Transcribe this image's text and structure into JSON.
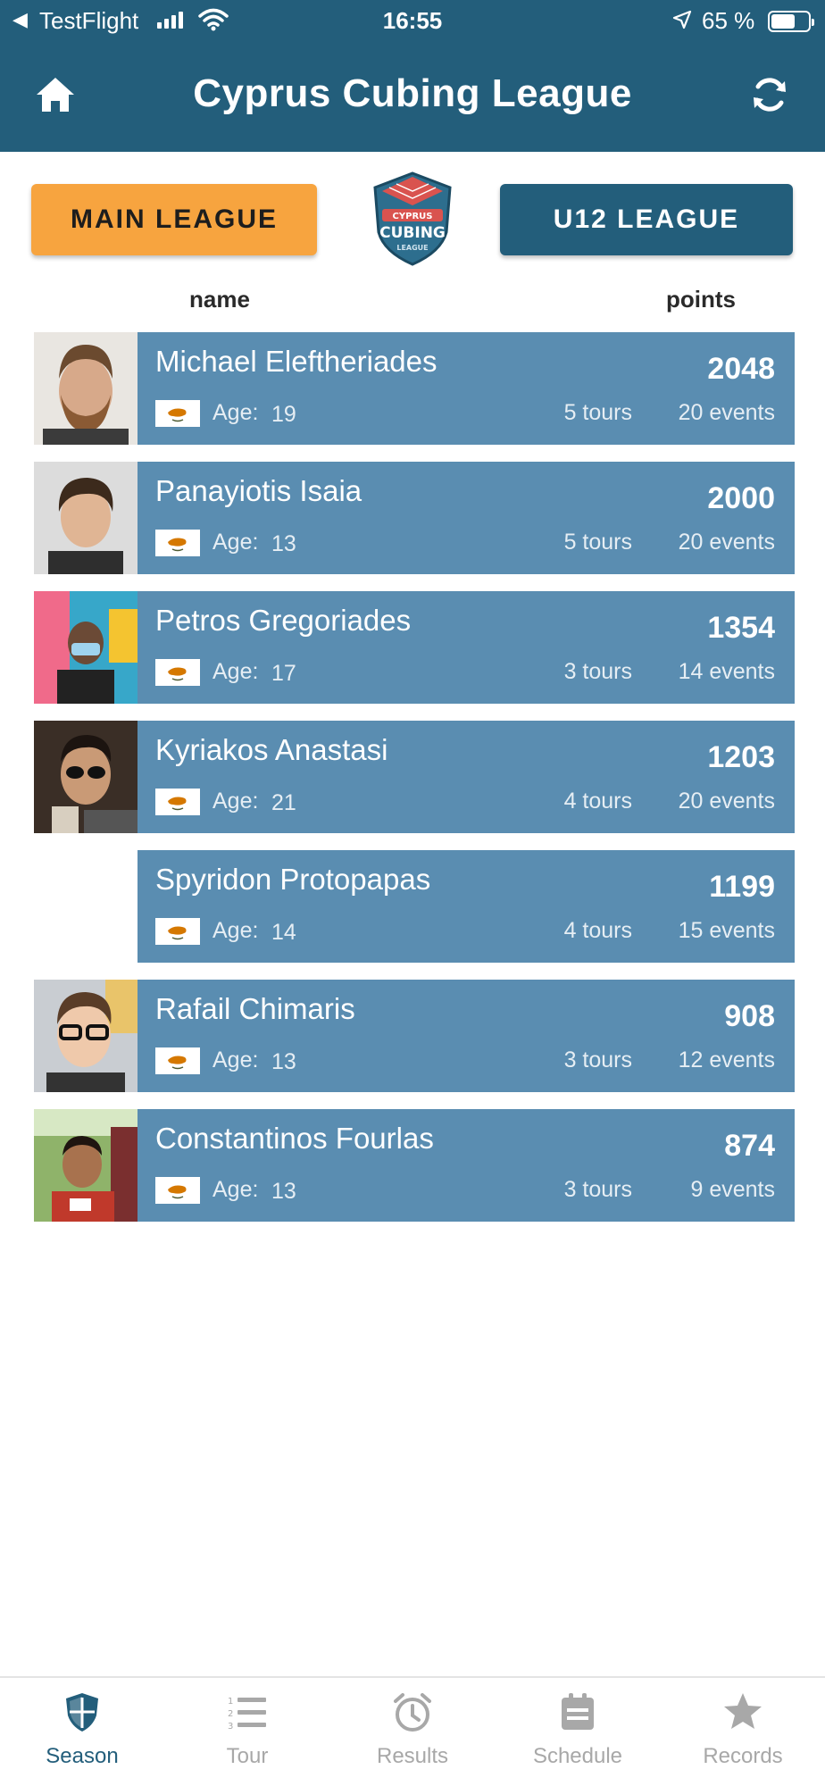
{
  "status_bar": {
    "back_glyph": "◀",
    "carrier": "TestFlight",
    "time": "16:55",
    "battery": "65 %"
  },
  "header": {
    "title": "Cyprus Cubing League",
    "home_icon": "home-icon",
    "refresh_icon": "refresh-icon"
  },
  "leagues": {
    "main_label": "MAIN LEAGUE",
    "u12_label": "U12 LEAGUE",
    "active": "main",
    "main_color": "#f7a43f",
    "u12_color": "#235e7b",
    "logo_text_top": "CYPRUS",
    "logo_text_mid": "CUBING",
    "logo_text_bottom": "LEAGUE"
  },
  "columns": {
    "name": "name",
    "points": "points"
  },
  "age_label": "Age:",
  "rankings": [
    {
      "name": "Michael Eleftheriades",
      "points": "2048",
      "age": "19",
      "tours": "5 tours",
      "events": "20 events",
      "has_photo": true
    },
    {
      "name": "Panayiotis Isaia",
      "points": "2000",
      "age": "13",
      "tours": "5 tours",
      "events": "20 events",
      "has_photo": true
    },
    {
      "name": "Petros Gregoriades",
      "points": "1354",
      "age": "17",
      "tours": "3 tours",
      "events": "14 events",
      "has_photo": true
    },
    {
      "name": "Kyriakos Anastasi",
      "points": "1203",
      "age": "21",
      "tours": "4 tours",
      "events": "20 events",
      "has_photo": true
    },
    {
      "name": "Spyridon Protopapas",
      "points": "1199",
      "age": "14",
      "tours": "4 tours",
      "events": "15 events",
      "has_photo": false
    },
    {
      "name": "Rafail Chimaris",
      "points": "908",
      "age": "13",
      "tours": "3 tours",
      "events": "12 events",
      "has_photo": true
    },
    {
      "name": "Constantinos Fourlas",
      "points": "874",
      "age": "13",
      "tours": "3 tours",
      "events": "9 events",
      "has_photo": true
    }
  ],
  "tabs": [
    {
      "label": "Season",
      "icon": "shield-icon",
      "active": true
    },
    {
      "label": "Tour",
      "icon": "numbered-list-icon",
      "active": false
    },
    {
      "label": "Results",
      "icon": "alarm-clock-icon",
      "active": false
    },
    {
      "label": "Schedule",
      "icon": "calendar-icon",
      "active": false
    },
    {
      "label": "Records",
      "icon": "star-icon",
      "active": false
    }
  ],
  "colors": {
    "header": "#235e7b",
    "card": "#5a8db1",
    "accent_orange": "#f7a43f",
    "tab_inactive": "#a8a8a8"
  }
}
